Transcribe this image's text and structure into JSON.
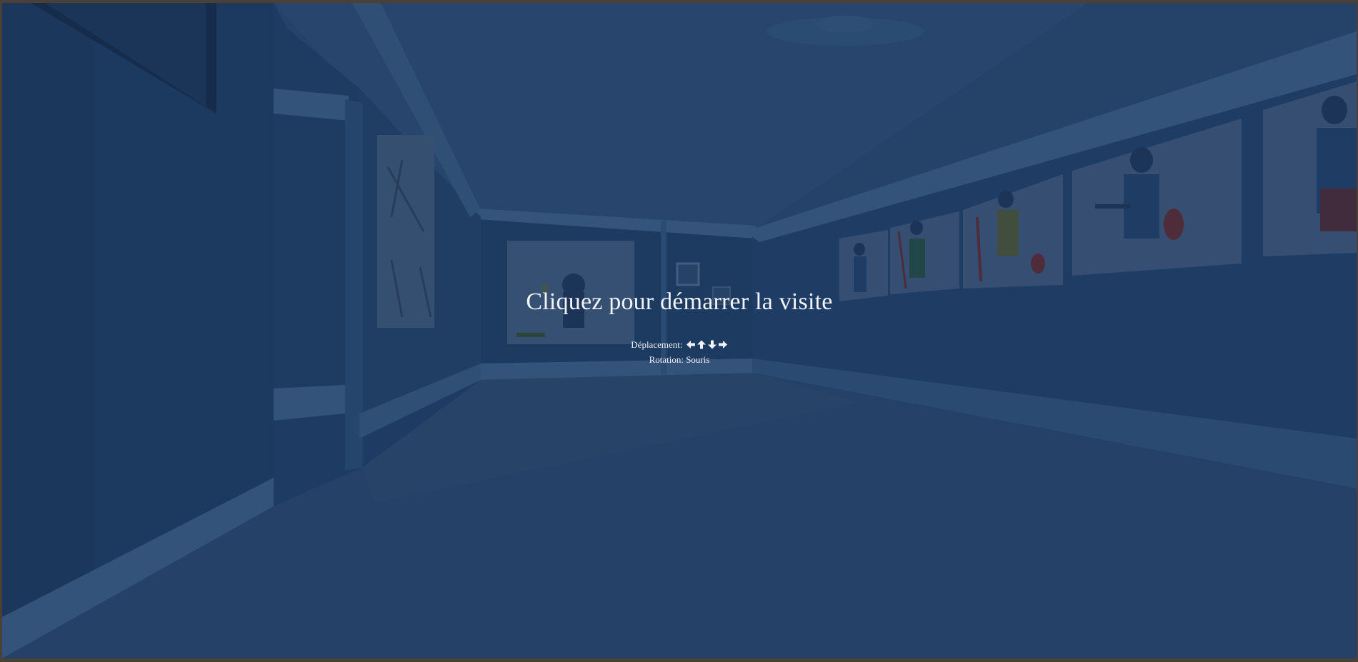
{
  "overlay": {
    "title": "Cliquez pour démarrer la visite",
    "move_label": "Déplacement:",
    "move_icons": [
      "arrow-left-icon",
      "arrow-up-icon",
      "arrow-down-icon",
      "arrow-right-icon"
    ],
    "rotation_label": "Rotation: Souris"
  },
  "colors": {
    "frame": "#4a4038",
    "wall": "#1f3d63",
    "ceiling": "#2a4a6e",
    "floor": "#2b4467",
    "trim": "#3a5a80",
    "text": "#f2f4f8"
  }
}
